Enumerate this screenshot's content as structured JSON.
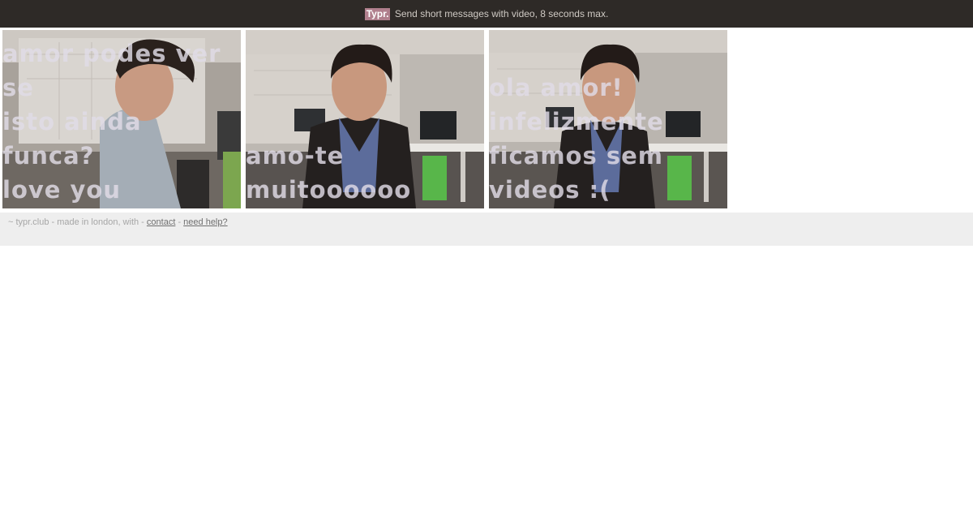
{
  "header": {
    "brand": "Typr.",
    "tagline": "Send short messages with video, 8 seconds max."
  },
  "messages": [
    {
      "caption": "amor podes ver se\nisto ainda funca?\nlove you"
    },
    {
      "caption": "amo-te\nmuitoooooo"
    },
    {
      "caption": "ola amor!\ninfelizmente\nficamos sem\nvideos :("
    }
  ],
  "footer": {
    "prefix": "~ typr.club - made in london, with -",
    "contact_label": "contact",
    "separator": "-",
    "help_label": "need help?"
  },
  "colors": {
    "topbar_bg": "#2e2a27",
    "brand_bg": "#b07f8d",
    "footer_bg": "#eeeeee"
  }
}
